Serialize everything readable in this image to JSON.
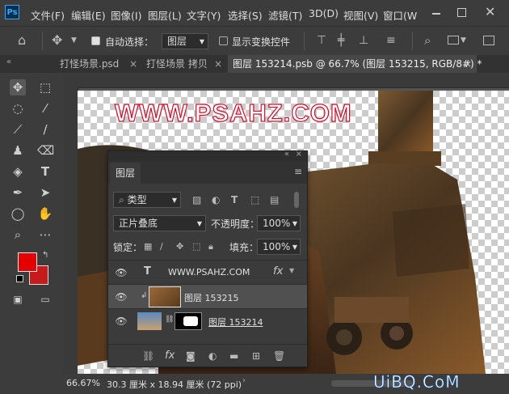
{
  "menu": {
    "logo": "Ps",
    "items": [
      "文件(F)",
      "编辑(E)",
      "图像(I)",
      "图层(L)",
      "文字(Y)",
      "选择(S)",
      "滤镜(T)",
      "3D(D)",
      "视图(V)",
      "窗口(W"
    ]
  },
  "options_bar": {
    "auto_select_label": "自动选择：",
    "auto_select_target": "图层",
    "show_transform_label": "显示变换控件"
  },
  "tabs": [
    {
      "label": "打怪场景.psd",
      "closable": true
    },
    {
      "label": "打怪场景 拷贝",
      "closable": true
    },
    {
      "label": "图层 153214.psb @ 66.7% (图层 153215, RGB/8#) *",
      "closable": true,
      "active": true
    }
  ],
  "colors": {
    "foreground": "#e50000",
    "background": "#c71a1a",
    "accent": "#31a8ff",
    "watermark": "#c8102e"
  },
  "watermark_text": "WWW.PSAHZ.COM",
  "layers_panel": {
    "title": "图层",
    "filter_label": "类型",
    "blend_mode": "正片叠底",
    "opacity_label": "不透明度：",
    "opacity_value": "100%",
    "lock_label": "锁定：",
    "fill_label": "填充：",
    "fill_value": "100%",
    "layers": [
      {
        "name": "WWW.PSAHZ.COM",
        "kind": "text",
        "fx": "fx",
        "selected": false
      },
      {
        "name": "图层 153215",
        "kind": "clipped",
        "selected": true
      },
      {
        "name": "图层 153214",
        "kind": "masked",
        "selected": false
      }
    ]
  },
  "status": {
    "zoom": "66.67%",
    "doc_size": "30.3 厘米 x 18.94 厘米 (72 ppi)"
  },
  "brand_watermark": "UiBQ.CoM"
}
